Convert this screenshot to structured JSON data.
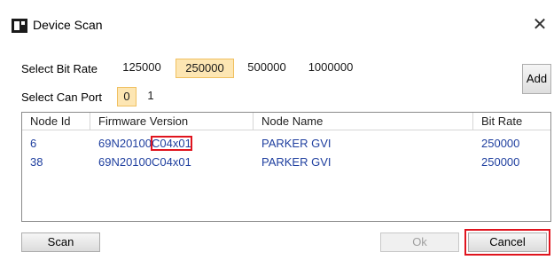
{
  "window": {
    "title": "Device Scan",
    "close_glyph": "✕"
  },
  "bit_rate": {
    "label": "Select Bit Rate",
    "options": [
      "125000",
      "250000",
      "500000",
      "1000000"
    ],
    "selected": "250000"
  },
  "can_port": {
    "label": "Select Can Port",
    "options": [
      "0",
      "1"
    ],
    "selected": "0"
  },
  "add_button": "Add",
  "table": {
    "columns": [
      "Node Id",
      "Firmware Version",
      "Node Name",
      "Bit Rate"
    ],
    "rows": [
      {
        "node_id": "6",
        "fw_prefix": "69N20100",
        "fw_suffix": "C04x01",
        "node_name": "PARKER GVI",
        "bit_rate": "250000"
      },
      {
        "node_id": "38",
        "fw_prefix": "69N20100C04x01",
        "fw_suffix": "",
        "node_name": "PARKER GVI",
        "bit_rate": "250000"
      }
    ]
  },
  "buttons": {
    "scan": "Scan",
    "ok": "Ok",
    "cancel": "Cancel"
  },
  "colors": {
    "selected_bg": "#fde6b3",
    "link_text": "#1f3f9f",
    "highlight": "#e0141e"
  },
  "icons": {
    "app": "device-scan-icon",
    "close": "close-icon"
  }
}
